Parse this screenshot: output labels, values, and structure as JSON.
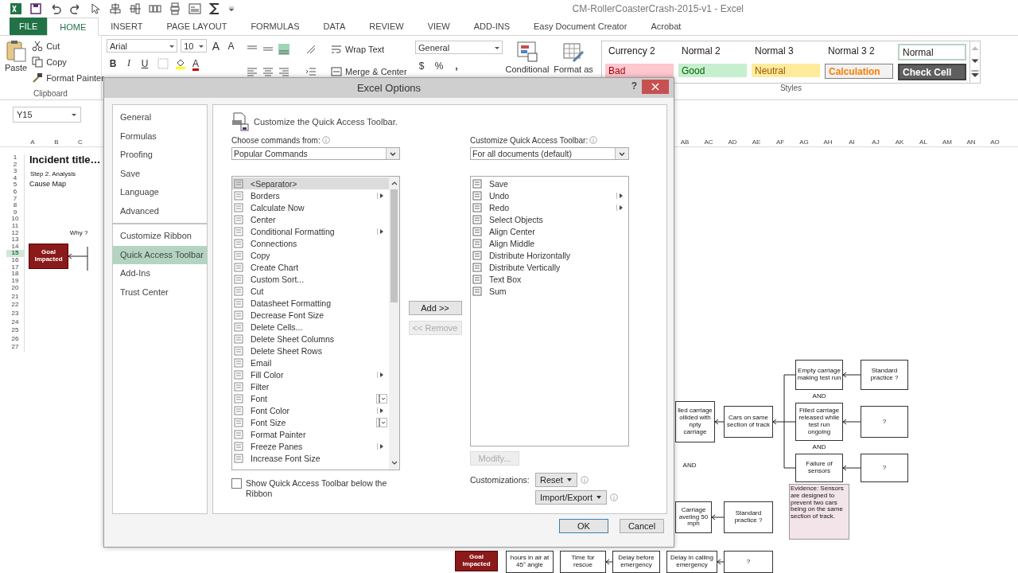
{
  "app": {
    "title": "CM-RollerCoasterCrash-2015-v1 - Excel"
  },
  "ribbon_tabs": [
    {
      "label": "FILE",
      "kind": "file",
      "selected": false
    },
    {
      "label": "HOME",
      "kind": "tab",
      "selected": true
    },
    {
      "label": "INSERT",
      "kind": "tab",
      "selected": false
    },
    {
      "label": "PAGE LAYOUT",
      "kind": "tab",
      "selected": false
    },
    {
      "label": "FORMULAS",
      "kind": "tab",
      "selected": false
    },
    {
      "label": "DATA",
      "kind": "tab",
      "selected": false
    },
    {
      "label": "REVIEW",
      "kind": "tab",
      "selected": false
    },
    {
      "label": "VIEW",
      "kind": "tab",
      "selected": false
    },
    {
      "label": "ADD-INS",
      "kind": "tab",
      "selected": false
    },
    {
      "label": "Easy Document Creator",
      "kind": "tab",
      "selected": false
    },
    {
      "label": "Acrobat",
      "kind": "tab",
      "selected": false
    }
  ],
  "clipboard": {
    "paste": "Paste",
    "cut": "Cut",
    "copy": "Copy",
    "format_painter": "Format Painter",
    "group": "Clipboard"
  },
  "font": {
    "name": "Arial",
    "size": "10",
    "grow": "A",
    "shrink": "A",
    "bold": "B",
    "italic": "I",
    "underline": "U",
    "font_color_letter": "A"
  },
  "alignment": {
    "wrap": "Wrap Text",
    "merge": "Merge & Center"
  },
  "number": {
    "format": "General",
    "currency": "$",
    "percent": "%",
    "comma": ","
  },
  "conditional": "Conditional",
  "format_table": "Format as",
  "styles": {
    "group": "Styles",
    "cells": [
      {
        "label": "Currency 2",
        "kind": "plain",
        "selected": false
      },
      {
        "label": "Normal 2",
        "kind": "plain",
        "selected": false
      },
      {
        "label": "Normal 3",
        "kind": "plain",
        "selected": false
      },
      {
        "label": "Normal 3 2",
        "kind": "plain",
        "selected": false
      },
      {
        "label": "Normal",
        "kind": "plain",
        "selected": true
      },
      {
        "label": "Bad",
        "kind": "bad",
        "selected": false
      },
      {
        "label": "Good",
        "kind": "good",
        "selected": false
      },
      {
        "label": "Neutral",
        "kind": "neutral",
        "selected": false
      },
      {
        "label": "Calculation",
        "kind": "calc",
        "selected": false
      },
      {
        "label": "Check Cell",
        "kind": "check",
        "selected": false
      }
    ]
  },
  "name_box": "Y15",
  "sheet": {
    "left_columns": [
      "A",
      "B",
      "C"
    ],
    "right_columns": [
      "AB",
      "AC",
      "AD",
      "AE",
      "AF",
      "AG",
      "AH",
      "AI",
      "AJ",
      "AK",
      "AL",
      "AM",
      "AN",
      "AO"
    ],
    "rows": [
      {
        "label": "1",
        "selected": false
      },
      {
        "label": "2",
        "selected": false
      },
      {
        "label": "3",
        "selected": false
      },
      {
        "label": "4",
        "selected": false
      },
      {
        "label": "5",
        "selected": false
      },
      {
        "label": "6",
        "selected": false
      },
      {
        "label": "7",
        "selected": false
      },
      {
        "label": "8",
        "selected": false
      },
      {
        "label": "9",
        "selected": false
      },
      {
        "label": "10",
        "selected": false
      },
      {
        "label": "11",
        "selected": false
      },
      {
        "label": "12",
        "selected": false
      },
      {
        "label": "13",
        "selected": false
      },
      {
        "label": "14",
        "selected": false
      },
      {
        "label": "15",
        "selected": true
      },
      {
        "label": "16",
        "selected": false
      },
      {
        "label": "17",
        "selected": false
      },
      {
        "label": "18",
        "selected": false
      },
      {
        "label": "19",
        "selected": false
      },
      {
        "label": "20",
        "selected": false
      },
      {
        "label": "21",
        "selected": false
      },
      {
        "label": "22",
        "selected": false
      },
      {
        "label": "23",
        "selected": false
      },
      {
        "label": "24",
        "selected": false
      },
      {
        "label": "25",
        "selected": false
      },
      {
        "label": "26",
        "selected": false
      },
      {
        "label": "27",
        "selected": false
      }
    ]
  },
  "diagram": {
    "nodes": [
      {
        "text": "Incident title…",
        "kind": "title"
      },
      {
        "text": "Step 2. Analysis",
        "kind": "subtitle"
      },
      {
        "text": "Cause Map",
        "kind": "heading"
      },
      {
        "text": "Why ?",
        "kind": "label"
      },
      {
        "text": "Goal Impacted",
        "kind": "goal"
      },
      {
        "text": "Empty carriage making test run",
        "kind": "box"
      },
      {
        "text": "Standard practice ?",
        "kind": "box"
      },
      {
        "text": "AND",
        "kind": "label"
      },
      {
        "text": "lled carriage ollided with npty carriage",
        "kind": "box"
      },
      {
        "text": "Cars on same section of track",
        "kind": "box"
      },
      {
        "text": "Filled carriage released while test run ongoing",
        "kind": "box"
      },
      {
        "text": "?",
        "kind": "box"
      },
      {
        "text": "AND",
        "kind": "label"
      },
      {
        "text": "AND",
        "kind": "label"
      },
      {
        "text": "Failure of sensors",
        "kind": "box"
      },
      {
        "text": "?",
        "kind": "box"
      },
      {
        "text": "Evidence: Sensors are designed to prevent two cars being on the same section of track.",
        "kind": "evidence"
      },
      {
        "text": "Carriage aveling 50 mph",
        "kind": "box"
      },
      {
        "text": "Standard practice ?",
        "kind": "box"
      },
      {
        "text": "Goal Impacted",
        "kind": "goal"
      },
      {
        "text": "hours in air at 45° angle",
        "kind": "box"
      },
      {
        "text": "Time for rescue",
        "kind": "box"
      },
      {
        "text": "Delay before emergency",
        "kind": "box"
      },
      {
        "text": "Delay in calling emergency",
        "kind": "box"
      },
      {
        "text": "?",
        "kind": "box"
      }
    ]
  },
  "dialog": {
    "title": "Excel Options",
    "help": "?",
    "nav": [
      {
        "label": "General",
        "selected": false,
        "separator_before": false
      },
      {
        "label": "Formulas",
        "selected": false,
        "separator_before": false
      },
      {
        "label": "Proofing",
        "selected": false,
        "separator_before": false
      },
      {
        "label": "Save",
        "selected": false,
        "separator_before": false
      },
      {
        "label": "Language",
        "selected": false,
        "separator_before": false
      },
      {
        "label": "Advanced",
        "selected": false,
        "separator_before": false
      },
      {
        "label": "Customize Ribbon",
        "selected": false,
        "separator_before": true
      },
      {
        "label": "Quick Access Toolbar",
        "selected": true,
        "separator_before": false
      },
      {
        "label": "Add-Ins",
        "selected": false,
        "separator_before": false
      },
      {
        "label": "Trust Center",
        "selected": false,
        "separator_before": false
      }
    ],
    "heading": "Customize the Quick Access Toolbar.",
    "choose_label": "Choose commands from:",
    "choose_value": "Popular Commands",
    "qat_label": "Customize Quick Access Toolbar:",
    "qat_value": "For all documents (default)",
    "commands": [
      {
        "label": "<Separator>",
        "kind": "plain",
        "selected": true
      },
      {
        "label": "Borders",
        "kind": "submenu",
        "selected": false
      },
      {
        "label": "Calculate Now",
        "kind": "plain",
        "selected": false
      },
      {
        "label": "Center",
        "kind": "plain",
        "selected": false
      },
      {
        "label": "Conditional Formatting",
        "kind": "submenu",
        "selected": false
      },
      {
        "label": "Connections",
        "kind": "plain",
        "selected": false
      },
      {
        "label": "Copy",
        "kind": "plain",
        "selected": false
      },
      {
        "label": "Create Chart",
        "kind": "plain",
        "selected": false
      },
      {
        "label": "Custom Sort...",
        "kind": "plain",
        "selected": false
      },
      {
        "label": "Cut",
        "kind": "plain",
        "selected": false
      },
      {
        "label": "Datasheet Formatting",
        "kind": "plain",
        "selected": false
      },
      {
        "label": "Decrease Font Size",
        "kind": "plain",
        "selected": false
      },
      {
        "label": "Delete Cells...",
        "kind": "plain",
        "selected": false
      },
      {
        "label": "Delete Sheet Columns",
        "kind": "plain",
        "selected": false
      },
      {
        "label": "Delete Sheet Rows",
        "kind": "plain",
        "selected": false
      },
      {
        "label": "Email",
        "kind": "plain",
        "selected": false
      },
      {
        "label": "Fill Color",
        "kind": "submenu",
        "selected": false
      },
      {
        "label": "Filter",
        "kind": "plain",
        "selected": false
      },
      {
        "label": "Font",
        "kind": "picker",
        "selected": false
      },
      {
        "label": "Font Color",
        "kind": "submenu",
        "selected": false
      },
      {
        "label": "Font Size",
        "kind": "picker",
        "selected": false
      },
      {
        "label": "Format Painter",
        "kind": "plain",
        "selected": false
      },
      {
        "label": "Freeze Panes",
        "kind": "submenu",
        "selected": false
      },
      {
        "label": "Increase Font Size",
        "kind": "plain",
        "selected": false
      }
    ],
    "toolbar": [
      {
        "label": "Save",
        "kind": "plain"
      },
      {
        "label": "Undo",
        "kind": "submenu"
      },
      {
        "label": "Redo",
        "kind": "submenu"
      },
      {
        "label": "Select Objects",
        "kind": "plain"
      },
      {
        "label": "Align Center",
        "kind": "plain"
      },
      {
        "label": "Align Middle",
        "kind": "plain"
      },
      {
        "label": "Distribute Horizontally",
        "kind": "plain"
      },
      {
        "label": "Distribute Vertically",
        "kind": "plain"
      },
      {
        "label": "Text Box",
        "kind": "plain"
      },
      {
        "label": "Sum",
        "kind": "plain"
      }
    ],
    "add": {
      "label": "Add >>",
      "disabled": false
    },
    "remove": {
      "label": "<< Remove",
      "disabled": true
    },
    "modify": {
      "label": "Modify...",
      "disabled": true
    },
    "customizations": "Customizations:",
    "reset": "Reset",
    "import_export": "Import/Export",
    "below_ribbon": {
      "label": "Show Quick Access Toolbar below the Ribbon",
      "checked": false
    },
    "ok": "OK",
    "cancel": "Cancel"
  }
}
